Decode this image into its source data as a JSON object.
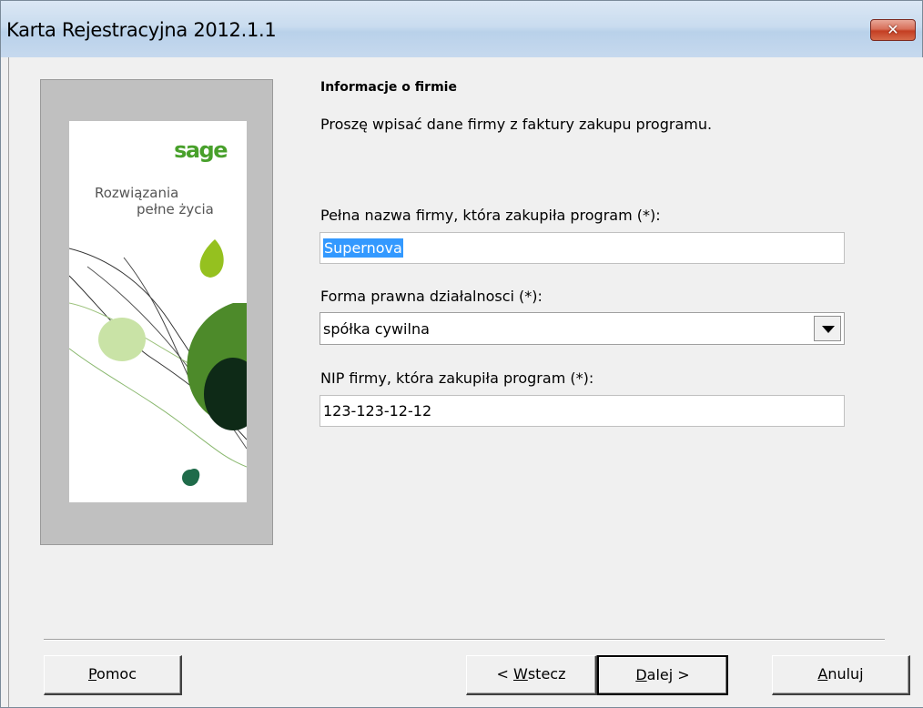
{
  "window": {
    "title": "Karta Rejestracyjna 2012.1.1",
    "close_label": "✕"
  },
  "sidebar": {
    "logo": "sage",
    "slogan_line1": "Rozwiązania",
    "slogan_line2": "pełne życia"
  },
  "form": {
    "heading": "Informacje o firmie",
    "subtitle": "Proszę wpisać dane firmy z faktury zakupu programu.",
    "company_name_label": "Pełna nazwa firmy, która zakupiła program (*):",
    "company_name_value": "Supernova",
    "legal_form_label": "Forma prawna działalnosci (*):",
    "legal_form_value": "spółka cywilna",
    "nip_label": "NIP firmy, która zakupiła program (*):",
    "nip_value": "123-123-12-12"
  },
  "buttons": {
    "help_first": "P",
    "help_rest": "omoc",
    "back_prefix": "< ",
    "back_first": "W",
    "back_rest": "stecz",
    "next_first": "D",
    "next_rest": "alej >",
    "cancel_first": "A",
    "cancel_rest": "nuluj"
  },
  "colors": {
    "selection": "#3399ff",
    "brand_green": "#48a02b",
    "close_red": "#c43e22"
  }
}
